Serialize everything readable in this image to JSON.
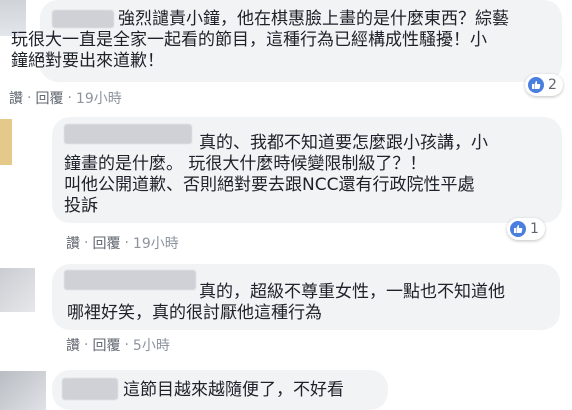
{
  "comments": [
    {
      "lines": [
        "強烈譴責小鐘，他在棋惠臉上畫的是什麼東西？綜藝",
        "玩很大一直是全家一起看的節目，這種行為已經構成性騷擾！小",
        "鐘絕對要出來道歉！"
      ],
      "actions": {
        "reply_label": "讚",
        "reply2_label": "回覆",
        "time": "19小時"
      },
      "reactions": {
        "icon": "thumbs-up-icon",
        "count": "2"
      }
    },
    {
      "lines": [
        "真的、我都不知道要怎麼跟小孩講，小",
        "鐘畫的是什麼。 玩很大什麼時候變限制級了？！",
        "叫他公開道歉、否則絕對要去跟NCC還有行政院性平處",
        "投訴"
      ],
      "actions": {
        "reply_label": "讚",
        "reply2_label": "回覆",
        "time": "19小時"
      },
      "reactions": {
        "icon": "thumbs-up-icon",
        "count": "1"
      }
    },
    {
      "lines": [
        "真的，超級不尊重女性，一點也不知道他",
        "哪裡好笑，真的很討厭他這種行為"
      ],
      "actions": {
        "reply_label": "讚",
        "reply2_label": "回覆",
        "time": "5小時"
      }
    },
    {
      "lines": [
        "這節目越來越隨便了，不好看"
      ]
    }
  ],
  "colors": {
    "bubble": "#f2f3f5",
    "like_blue": "#4a7fe0",
    "meta_text": "#8d949e"
  }
}
